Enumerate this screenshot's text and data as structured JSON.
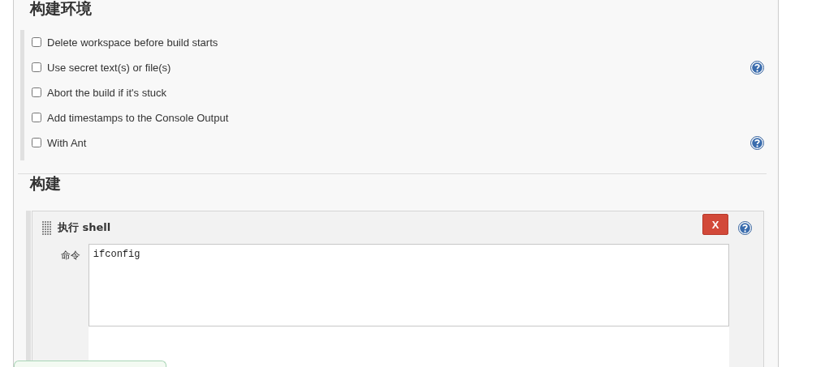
{
  "environment": {
    "title": "构建环境",
    "options": [
      {
        "label": "Delete workspace before build starts",
        "checked": false,
        "help": false
      },
      {
        "label": "Use secret text(s) or file(s)",
        "checked": false,
        "help": true
      },
      {
        "label": "Abort the build if it's stuck",
        "checked": false,
        "help": false
      },
      {
        "label": "Add timestamps to the Console Output",
        "checked": false,
        "help": false
      },
      {
        "label": "With Ant",
        "checked": false,
        "help": true
      }
    ]
  },
  "build": {
    "title": "构建",
    "steps": [
      {
        "title": "执行 shell",
        "delete_label": "X",
        "help": true,
        "fields": [
          {
            "label": "命令",
            "value": "ifconfig"
          }
        ]
      }
    ]
  }
}
